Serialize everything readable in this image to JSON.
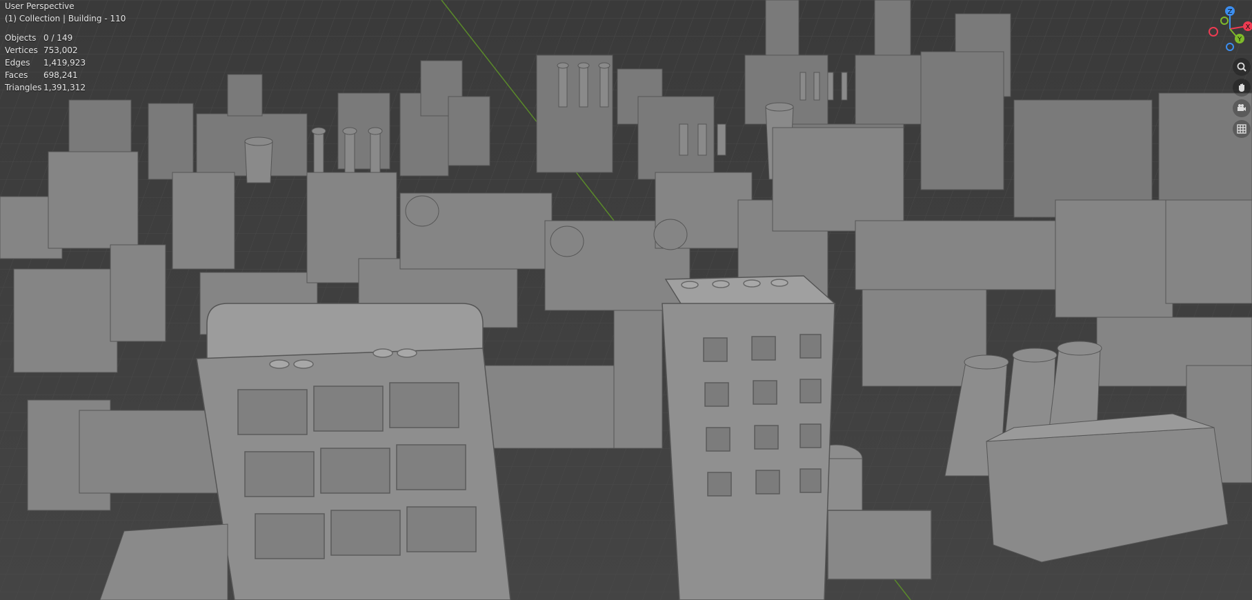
{
  "viewport": {
    "view_name": "User Perspective",
    "collection_info": "(1) Collection | Building - 110"
  },
  "stats": [
    {
      "label": "Objects",
      "value": "0 / 149"
    },
    {
      "label": "Vertices",
      "value": "753,002"
    },
    {
      "label": "Edges",
      "value": "1,419,923"
    },
    {
      "label": "Faces",
      "value": "698,241"
    },
    {
      "label": "Triangles",
      "value": "1,391,312"
    }
  ],
  "gizmo": {
    "axes": [
      {
        "name": "X",
        "color": "#ee3b52"
      },
      {
        "name": "Y",
        "color": "#7fbb2a"
      },
      {
        "name": "Z",
        "color": "#3c8ef0"
      }
    ]
  },
  "nav_buttons": [
    "zoom-icon",
    "pan-hand-icon",
    "camera-icon",
    "grid-icon"
  ]
}
